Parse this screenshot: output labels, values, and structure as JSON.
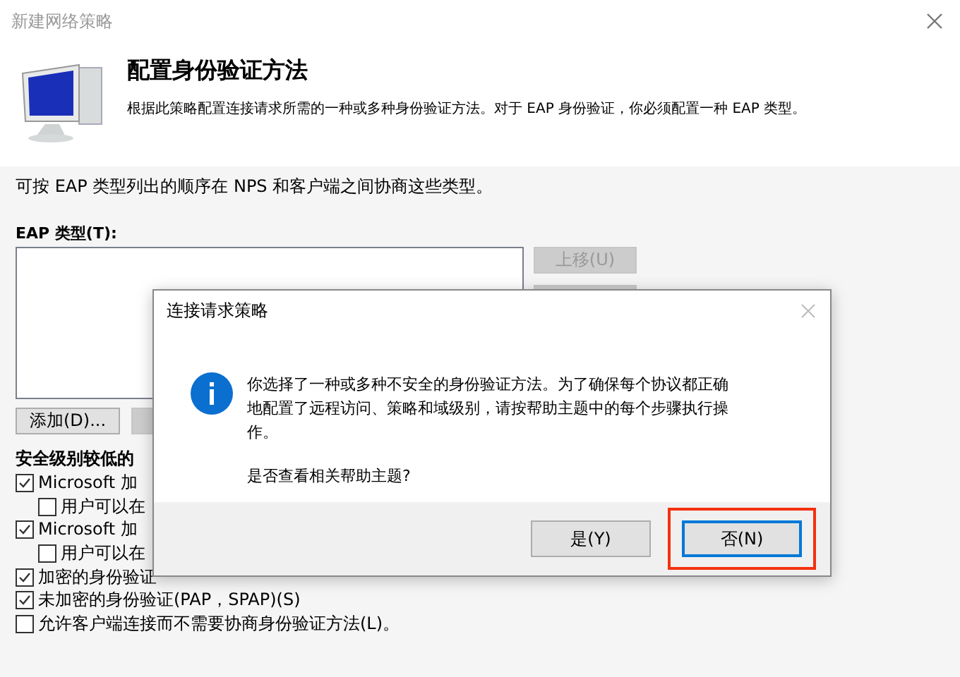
{
  "window": {
    "title": "新建网络策略"
  },
  "header": {
    "title": "配置身份验证方法",
    "description": "根据此策略配置连接请求所需的一种或多种身份验证方法。对于 EAP 身份验证，你必须配置一种 EAP 类型。"
  },
  "intro": "可按 EAP 类型列出的顺序在 NPS 和客户端之间协商这些类型。",
  "eap_label": "EAP 类型(T):",
  "side_buttons": [
    {
      "label": "上移(U)",
      "disabled": true
    }
  ],
  "add_button": "添加(D)...",
  "section_title": "安全级别较低的",
  "checkboxes": [
    {
      "label": "Microsoft 加",
      "checked": true,
      "children": [
        {
          "label": "用户可以在",
          "checked": false
        }
      ]
    },
    {
      "label": "Microsoft 加",
      "checked": true,
      "children": [
        {
          "label": "用户可以在",
          "checked": false
        }
      ]
    },
    {
      "label": "加密的身份验证",
      "checked": true
    },
    {
      "label": "未加密的身份验证(PAP，SPAP)(S)",
      "checked": true
    },
    {
      "label": "允许客户端连接而不需要协商身份验证方法(L)。",
      "checked": false
    }
  ],
  "dialog": {
    "title": "连接请求策略",
    "message": "你选择了一种或多种不安全的身份验证方法。为了确保每个协议都正确地配置了远程访问、策略和域级别，请按帮助主题中的每个步骤执行操作。",
    "question": "是否查看相关帮助主题?",
    "buttons": [
      {
        "label": "是(Y)",
        "selected": false,
        "highlighted": false
      },
      {
        "label": "否(N)",
        "selected": true,
        "highlighted": true
      }
    ]
  }
}
